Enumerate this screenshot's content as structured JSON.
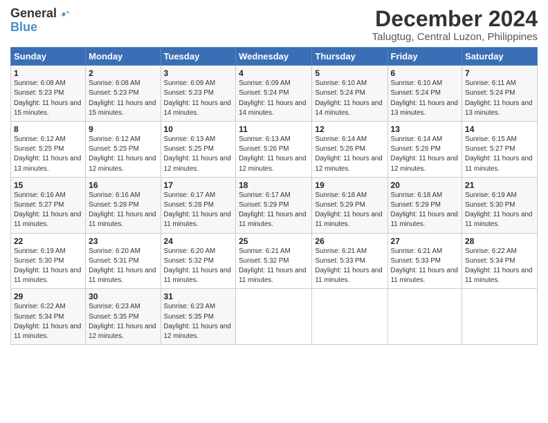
{
  "logo": {
    "general": "General",
    "blue": "Blue"
  },
  "title": "December 2024",
  "subtitle": "Talugtug, Central Luzon, Philippines",
  "weekdays": [
    "Sunday",
    "Monday",
    "Tuesday",
    "Wednesday",
    "Thursday",
    "Friday",
    "Saturday"
  ],
  "weeks": [
    [
      {
        "day": "1",
        "sunrise": "Sunrise: 6:08 AM",
        "sunset": "Sunset: 5:23 PM",
        "daylight": "Daylight: 11 hours and 15 minutes."
      },
      {
        "day": "2",
        "sunrise": "Sunrise: 6:08 AM",
        "sunset": "Sunset: 5:23 PM",
        "daylight": "Daylight: 11 hours and 15 minutes."
      },
      {
        "day": "3",
        "sunrise": "Sunrise: 6:09 AM",
        "sunset": "Sunset: 5:23 PM",
        "daylight": "Daylight: 11 hours and 14 minutes."
      },
      {
        "day": "4",
        "sunrise": "Sunrise: 6:09 AM",
        "sunset": "Sunset: 5:24 PM",
        "daylight": "Daylight: 11 hours and 14 minutes."
      },
      {
        "day": "5",
        "sunrise": "Sunrise: 6:10 AM",
        "sunset": "Sunset: 5:24 PM",
        "daylight": "Daylight: 11 hours and 14 minutes."
      },
      {
        "day": "6",
        "sunrise": "Sunrise: 6:10 AM",
        "sunset": "Sunset: 5:24 PM",
        "daylight": "Daylight: 11 hours and 13 minutes."
      },
      {
        "day": "7",
        "sunrise": "Sunrise: 6:11 AM",
        "sunset": "Sunset: 5:24 PM",
        "daylight": "Daylight: 11 hours and 13 minutes."
      }
    ],
    [
      {
        "day": "8",
        "sunrise": "Sunrise: 6:12 AM",
        "sunset": "Sunset: 5:25 PM",
        "daylight": "Daylight: 11 hours and 13 minutes."
      },
      {
        "day": "9",
        "sunrise": "Sunrise: 6:12 AM",
        "sunset": "Sunset: 5:25 PM",
        "daylight": "Daylight: 11 hours and 12 minutes."
      },
      {
        "day": "10",
        "sunrise": "Sunrise: 6:13 AM",
        "sunset": "Sunset: 5:25 PM",
        "daylight": "Daylight: 11 hours and 12 minutes."
      },
      {
        "day": "11",
        "sunrise": "Sunrise: 6:13 AM",
        "sunset": "Sunset: 5:26 PM",
        "daylight": "Daylight: 11 hours and 12 minutes."
      },
      {
        "day": "12",
        "sunrise": "Sunrise: 6:14 AM",
        "sunset": "Sunset: 5:26 PM",
        "daylight": "Daylight: 11 hours and 12 minutes."
      },
      {
        "day": "13",
        "sunrise": "Sunrise: 6:14 AM",
        "sunset": "Sunset: 5:26 PM",
        "daylight": "Daylight: 11 hours and 12 minutes."
      },
      {
        "day": "14",
        "sunrise": "Sunrise: 6:15 AM",
        "sunset": "Sunset: 5:27 PM",
        "daylight": "Daylight: 11 hours and 11 minutes."
      }
    ],
    [
      {
        "day": "15",
        "sunrise": "Sunrise: 6:16 AM",
        "sunset": "Sunset: 5:27 PM",
        "daylight": "Daylight: 11 hours and 11 minutes."
      },
      {
        "day": "16",
        "sunrise": "Sunrise: 6:16 AM",
        "sunset": "Sunset: 5:28 PM",
        "daylight": "Daylight: 11 hours and 11 minutes."
      },
      {
        "day": "17",
        "sunrise": "Sunrise: 6:17 AM",
        "sunset": "Sunset: 5:28 PM",
        "daylight": "Daylight: 11 hours and 11 minutes."
      },
      {
        "day": "18",
        "sunrise": "Sunrise: 6:17 AM",
        "sunset": "Sunset: 5:29 PM",
        "daylight": "Daylight: 11 hours and 11 minutes."
      },
      {
        "day": "19",
        "sunrise": "Sunrise: 6:18 AM",
        "sunset": "Sunset: 5:29 PM",
        "daylight": "Daylight: 11 hours and 11 minutes."
      },
      {
        "day": "20",
        "sunrise": "Sunrise: 6:18 AM",
        "sunset": "Sunset: 5:29 PM",
        "daylight": "Daylight: 11 hours and 11 minutes."
      },
      {
        "day": "21",
        "sunrise": "Sunrise: 6:19 AM",
        "sunset": "Sunset: 5:30 PM",
        "daylight": "Daylight: 11 hours and 11 minutes."
      }
    ],
    [
      {
        "day": "22",
        "sunrise": "Sunrise: 6:19 AM",
        "sunset": "Sunset: 5:30 PM",
        "daylight": "Daylight: 11 hours and 11 minutes."
      },
      {
        "day": "23",
        "sunrise": "Sunrise: 6:20 AM",
        "sunset": "Sunset: 5:31 PM",
        "daylight": "Daylight: 11 hours and 11 minutes."
      },
      {
        "day": "24",
        "sunrise": "Sunrise: 6:20 AM",
        "sunset": "Sunset: 5:32 PM",
        "daylight": "Daylight: 11 hours and 11 minutes."
      },
      {
        "day": "25",
        "sunrise": "Sunrise: 6:21 AM",
        "sunset": "Sunset: 5:32 PM",
        "daylight": "Daylight: 11 hours and 11 minutes."
      },
      {
        "day": "26",
        "sunrise": "Sunrise: 6:21 AM",
        "sunset": "Sunset: 5:33 PM",
        "daylight": "Daylight: 11 hours and 11 minutes."
      },
      {
        "day": "27",
        "sunrise": "Sunrise: 6:21 AM",
        "sunset": "Sunset: 5:33 PM",
        "daylight": "Daylight: 11 hours and 11 minutes."
      },
      {
        "day": "28",
        "sunrise": "Sunrise: 6:22 AM",
        "sunset": "Sunset: 5:34 PM",
        "daylight": "Daylight: 11 hours and 11 minutes."
      }
    ],
    [
      {
        "day": "29",
        "sunrise": "Sunrise: 6:22 AM",
        "sunset": "Sunset: 5:34 PM",
        "daylight": "Daylight: 11 hours and 11 minutes."
      },
      {
        "day": "30",
        "sunrise": "Sunrise: 6:23 AM",
        "sunset": "Sunset: 5:35 PM",
        "daylight": "Daylight: 11 hours and 12 minutes."
      },
      {
        "day": "31",
        "sunrise": "Sunrise: 6:23 AM",
        "sunset": "Sunset: 5:35 PM",
        "daylight": "Daylight: 11 hours and 12 minutes."
      },
      null,
      null,
      null,
      null
    ]
  ]
}
